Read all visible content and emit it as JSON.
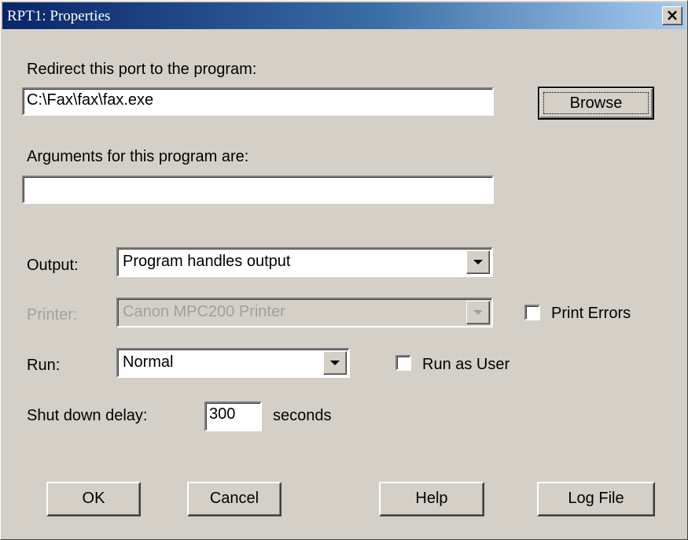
{
  "window": {
    "title": "RPT1: Properties",
    "close_label": "×"
  },
  "program": {
    "label": "Redirect this port to the program:",
    "value": "C:\\Fax\\fax\\fax.exe",
    "browse_label": "Browse"
  },
  "arguments": {
    "label": "Arguments for this program are:",
    "value": ""
  },
  "output": {
    "label": "Output:",
    "selected": "Program handles output"
  },
  "printer": {
    "label": "Printer:",
    "selected": "Canon MPC200 Printer",
    "print_errors_label": "Print Errors",
    "print_errors_checked": false
  },
  "run": {
    "label": "Run:",
    "selected": "Normal",
    "run_as_user_label": "Run as User",
    "run_as_user_checked": false
  },
  "shutdown": {
    "label": "Shut down delay:",
    "value": "300",
    "unit": "seconds"
  },
  "buttons": {
    "ok": "OK",
    "cancel": "Cancel",
    "help": "Help",
    "log_file": "Log File"
  }
}
